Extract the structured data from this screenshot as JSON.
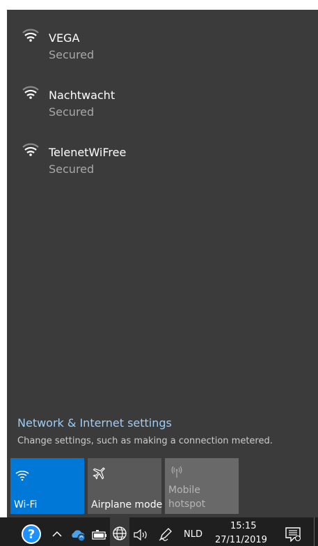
{
  "networks": [
    {
      "name": "VEGA",
      "status": "Secured",
      "icon": "wifi-icon"
    },
    {
      "name": "Nachtwacht",
      "status": "Secured",
      "icon": "wifi-icon"
    },
    {
      "name": "TelenetWiFree",
      "status": "Secured",
      "icon": "wifi-icon"
    }
  ],
  "settings": {
    "link": "Network & Internet settings",
    "description": "Change settings, such as making a connection metered."
  },
  "tiles": {
    "wifi": {
      "label": "Wi-Fi",
      "icon": "wifi-icon",
      "active": true,
      "color": "#0078d7"
    },
    "airplane": {
      "label": "Airplane mode",
      "icon": "airplane-icon",
      "active": false,
      "color": "#595959"
    },
    "hotspot": {
      "label_line1": "Mobile",
      "label_line2": "hotspot",
      "icon": "hotspot-icon",
      "active": false,
      "disabled": true,
      "color": "#696969"
    }
  },
  "taskbar": {
    "language": "NLD",
    "time": "15:15",
    "date": "27/11/2019",
    "icons": [
      "help-icon",
      "chevron-up-icon",
      "onedrive-icon",
      "battery-icon",
      "network-icon",
      "volume-icon",
      "pen-icon",
      "action-center-icon"
    ]
  },
  "colors": {
    "panel_bg": "#3b3b3b",
    "accent": "#0078d7",
    "link": "#9ecdf6",
    "taskbar_bg": "#1f1f1f"
  }
}
